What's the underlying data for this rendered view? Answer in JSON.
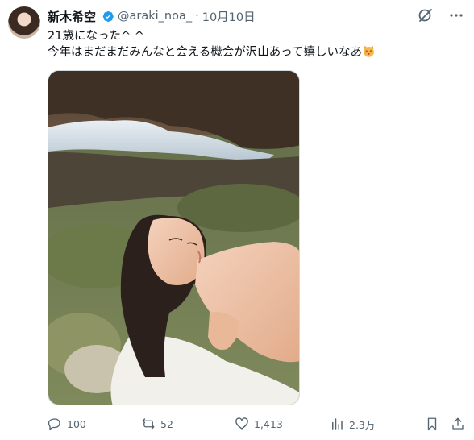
{
  "author": {
    "name": "新木希空",
    "handle": "@araki_noa_",
    "separator": "·",
    "date": "10月10日"
  },
  "icons": {
    "verified": "verified-badge-icon",
    "grok": "grok-icon",
    "more": "more-options-icon",
    "reply": "reply-icon",
    "repost": "repost-icon",
    "like": "like-icon",
    "views": "views-icon",
    "bookmark": "bookmark-icon",
    "share": "share-icon",
    "emoji": "kissing-cat-emoji"
  },
  "tweet": {
    "line1": "21歳になった^ ^",
    "line2": "今年はまだまだみんなと会える機会が沢山あって嬉しいなあ"
  },
  "metrics": {
    "replies": "100",
    "reposts": "52",
    "likes": "1,413",
    "views": "2.3万"
  },
  "colors": {
    "accent": "#1d9bf0",
    "text": "#0f1419",
    "secondary": "#536471"
  }
}
